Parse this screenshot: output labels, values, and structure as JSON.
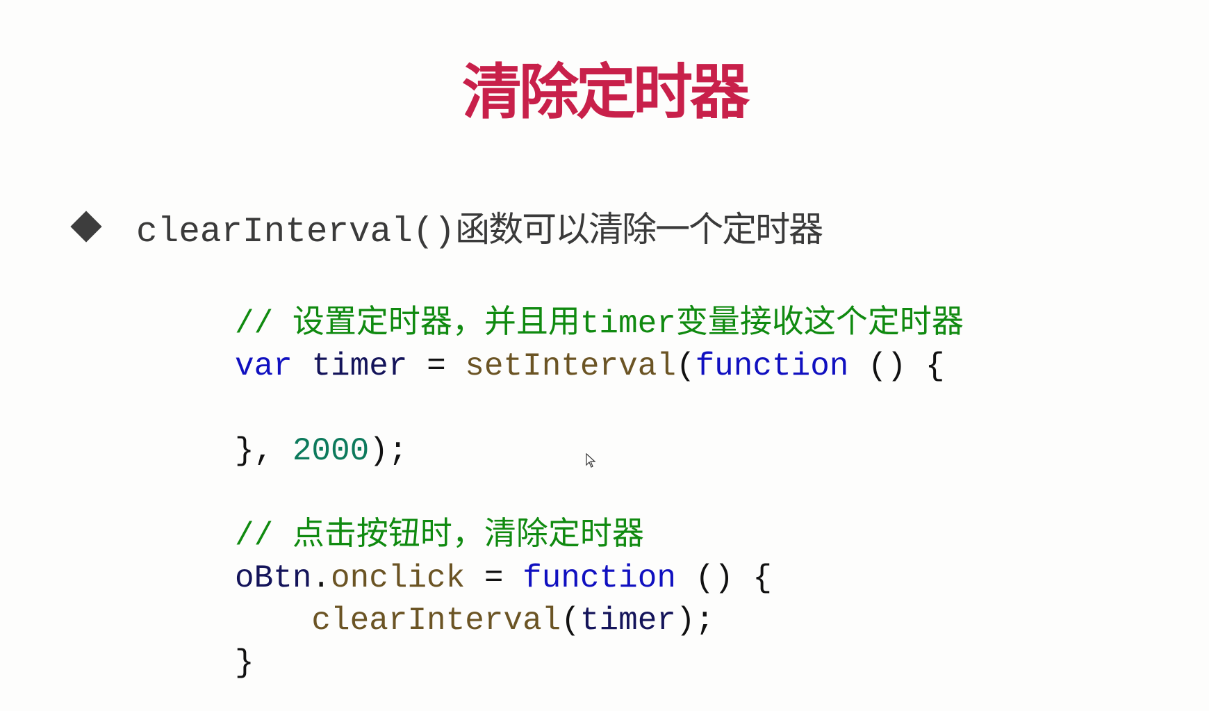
{
  "slide": {
    "title": "清除定时器",
    "bullet": {
      "code_part": "clearInterval()",
      "text_part": "函数可以清除一个定时器"
    },
    "code_lines": [
      [
        {
          "t": "// 设置定时器，并且用timer变量接收这个定时器",
          "c": "comment"
        }
      ],
      [
        {
          "t": "var",
          "c": "keyword"
        },
        {
          "t": " ",
          "c": "punct"
        },
        {
          "t": "timer",
          "c": "ident"
        },
        {
          "t": " = ",
          "c": "punct"
        },
        {
          "t": "setInterval",
          "c": "fn"
        },
        {
          "t": "(",
          "c": "punct"
        },
        {
          "t": "function",
          "c": "keyword"
        },
        {
          "t": " () {",
          "c": "punct"
        }
      ],
      [],
      [
        {
          "t": "}, ",
          "c": "punct"
        },
        {
          "t": "2000",
          "c": "num"
        },
        {
          "t": ");",
          "c": "punct"
        }
      ],
      [],
      [
        {
          "t": "// 点击按钮时，清除定时器",
          "c": "comment"
        }
      ],
      [
        {
          "t": "oBtn",
          "c": "ident"
        },
        {
          "t": ".",
          "c": "punct"
        },
        {
          "t": "onclick",
          "c": "fn"
        },
        {
          "t": " = ",
          "c": "punct"
        },
        {
          "t": "function",
          "c": "keyword"
        },
        {
          "t": " () {",
          "c": "punct"
        }
      ],
      [
        {
          "t": "    ",
          "c": "punct"
        },
        {
          "t": "clearInterval",
          "c": "fn"
        },
        {
          "t": "(",
          "c": "punct"
        },
        {
          "t": "timer",
          "c": "ident"
        },
        {
          "t": ");",
          "c": "punct"
        }
      ],
      [
        {
          "t": "}",
          "c": "punct"
        }
      ]
    ]
  },
  "colors": {
    "title": "#c8204a",
    "comment": "#108a10",
    "keyword": "#1010c0",
    "identifier": "#14145a",
    "function": "#6b5424",
    "number": "#0d7a5c"
  }
}
